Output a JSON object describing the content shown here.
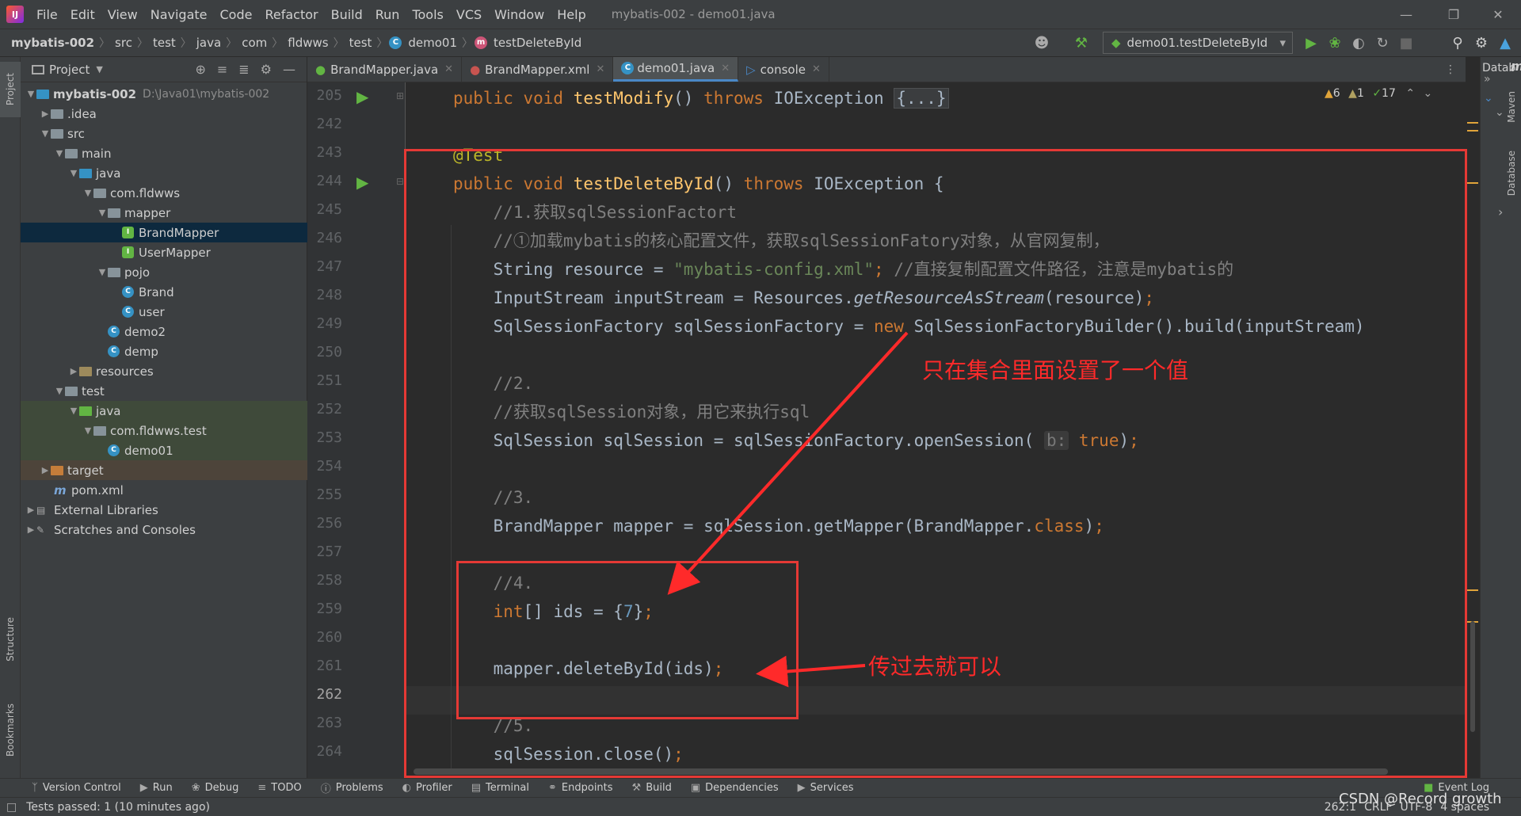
{
  "menubar": {
    "items": [
      "File",
      "Edit",
      "View",
      "Navigate",
      "Code",
      "Refactor",
      "Build",
      "Run",
      "Tools",
      "VCS",
      "Window",
      "Help"
    ],
    "window_title": "mybatis-002 - demo01.java"
  },
  "breadcrumb": {
    "project": "mybatis-002",
    "parts": [
      "src",
      "test",
      "java",
      "com",
      "fldwws",
      "test",
      "demo01",
      "testDeleteById"
    ]
  },
  "run_config": {
    "label": "demo01.testDeleteById"
  },
  "project_panel": {
    "title": "Project",
    "root_name": "mybatis-002",
    "root_path": "D:\\Java01\\mybatis-002",
    "rows": [
      {
        "label": ".idea"
      },
      {
        "label": "src"
      },
      {
        "label": "main"
      },
      {
        "label": "java"
      },
      {
        "label": "com.fldwws"
      },
      {
        "label": "mapper"
      },
      {
        "label": "BrandMapper"
      },
      {
        "label": "UserMapper"
      },
      {
        "label": "pojo"
      },
      {
        "label": "Brand"
      },
      {
        "label": "user"
      },
      {
        "label": "demo2"
      },
      {
        "label": "demp"
      },
      {
        "label": "resources"
      },
      {
        "label": "test"
      },
      {
        "label": "java"
      },
      {
        "label": "com.fldwws.test"
      },
      {
        "label": "demo01"
      },
      {
        "label": "target"
      },
      {
        "label": "pom.xml"
      },
      {
        "label": "External Libraries"
      },
      {
        "label": "Scratches and Consoles"
      }
    ]
  },
  "editor_tabs": [
    {
      "label": "BrandMapper.java"
    },
    {
      "label": "BrandMapper.xml"
    },
    {
      "label": "demo01.java"
    },
    {
      "label": "console"
    }
  ],
  "inspections": {
    "warnings": "6",
    "weak_warnings": "1",
    "typos": "17"
  },
  "line_numbers": [
    "205",
    "242",
    "243",
    "244",
    "245",
    "246",
    "247",
    "248",
    "249",
    "250",
    "251",
    "252",
    "253",
    "254",
    "255",
    "256",
    "257",
    "258",
    "259",
    "260",
    "261",
    "262",
    "263",
    "264"
  ],
  "code": {
    "l205": {
      "kw1": "public void ",
      "fn": "testModify",
      "p": "() ",
      "kw2": "throws ",
      "t": "IOException ",
      "fold": "{...}"
    },
    "l243": {
      "an": "@Test"
    },
    "l244": {
      "kw1": "public void ",
      "fn": "testDeleteById",
      "p": "() ",
      "kw2": "throws ",
      "t": "IOException {"
    },
    "l245": "    //1.获取sqlSessionFactort",
    "l246": "    //①加载mybatis的核心配置文件，获取sqlSessionFatory对象，从官网复制，",
    "l247": {
      "a": "    String resource = ",
      "s": "\"mybatis-config.xml\"",
      "k": ";",
      "c": " //直接复制配置文件路径，注意是mybatis的"
    },
    "l248": {
      "a": "    InputStream inputStream = Resources.",
      "i": "getResourceAsStream",
      "b": "(resource)",
      "k": ";"
    },
    "l249": {
      "a": "    SqlSessionFactory sqlSessionFactory = ",
      "k": "new ",
      "b": "SqlSessionFactoryBuilder().build(inputStream)"
    },
    "l251": "    //2.",
    "l252": "    //获取sqlSession对象，用它来执行sql",
    "l253": {
      "a": "    SqlSession sqlSession = sqlSessionFactory.openSession( ",
      "h": "b:",
      "k": " true",
      "b": ")",
      "s": ";"
    },
    "l255": "    //3.",
    "l256": {
      "a": "    BrandMapper mapper = sqlSession.getMapper(BrandMapper.",
      "k": "class",
      "b": ")",
      "s": ";"
    },
    "l258": "    //4.",
    "l259": {
      "k": "    int",
      "a": "[] ids = {",
      "n": "7",
      "b": "}",
      "s": ";"
    },
    "l261": {
      "a": "    mapper.deleteById(ids)",
      "s": ";"
    },
    "l263": "    //5.",
    "l264": {
      "a": "    sqlSession.close()",
      "s": ";"
    }
  },
  "annotations": {
    "label1": "只在集合里面设置了一个值",
    "label2": "传过去就可以"
  },
  "right_tools": {
    "datab": "Datab",
    "maven": "Maven",
    "database": "Database"
  },
  "left_tools": {
    "project": "Project",
    "structure": "Structure",
    "bookmarks": "Bookmarks"
  },
  "bottom_tools": [
    "Version Control",
    "Run",
    "Debug",
    "TODO",
    "Problems",
    "Profiler",
    "Terminal",
    "Endpoints",
    "Build",
    "Dependencies",
    "Services"
  ],
  "event_log": "Event Log",
  "status": {
    "message": "Tests passed: 1 (10 minutes ago)",
    "position": "262:1",
    "line_sep": "CRLF",
    "encoding": "UTF-8",
    "indent": "4 spaces"
  },
  "watermark": "CSDN @Record growth",
  "colors": {
    "accent": "#4a88c7",
    "annotation_red": "#e53935",
    "keyword": "#cc7832",
    "function": "#ffc66d",
    "comment": "#808080",
    "string": "#6a8759"
  }
}
